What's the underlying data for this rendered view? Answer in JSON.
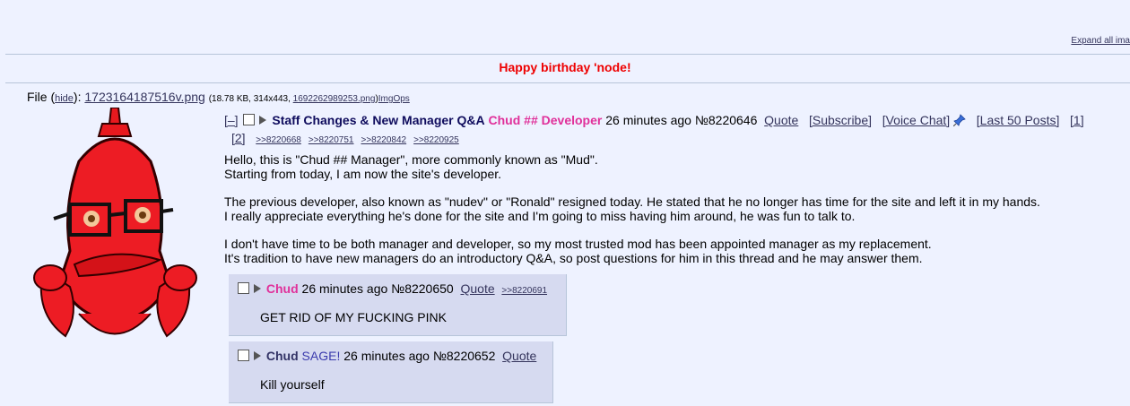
{
  "header": {
    "expand_label": "Expand all ima",
    "banner": "Happy birthday 'node!"
  },
  "file": {
    "label": "File (",
    "hide_label": "hide",
    "label_close": "):",
    "filename": "1723164187516v.png",
    "meta_prefix": "(18.78 KB, 314x443,",
    "orig_name": "1692262989253.png",
    "meta_suffix": ")",
    "imgops": "ImgOps"
  },
  "op": {
    "collapse": "[–]",
    "subject": "Staff Changes & New Manager Q&A",
    "name": "Chud",
    "trip": "## Developer",
    "time": "26 minutes ago",
    "post_no": "№8220646",
    "quote": "Quote",
    "subscribe": "[Subscribe]",
    "voice_chat": "[Voice Chat]",
    "last50": "[Last 50 Posts]",
    "page1": "[1]",
    "page2": "[2]",
    "backlinks": [
      ">>8220668",
      ">>8220751",
      ">>8220842",
      ">>8220925"
    ],
    "paragraphs": [
      [
        "Hello, this is \"Chud ## Manager\", more commonly known as \"Mud\".",
        "Starting from today, I am now the site's developer."
      ],
      [
        "The previous developer, also known as \"nudev\" or \"Ronald\" resigned today. He stated that he no longer has time for the site and left it in my hands.",
        "I really appreciate everything he's done for the site and I'm going to miss having him around, he was fun to talk to."
      ],
      [
        "I don't have time to be both manager and developer, so my most trusted mod has been appointed manager as my replacement.",
        "It's tradition to have new managers do an introductory Q&A, so post questions for him in this thread and he may answer them."
      ]
    ]
  },
  "replies": [
    {
      "name": "Chud",
      "time": "26 minutes ago",
      "post_no": "№8220650",
      "quote": "Quote",
      "backlink": ">>8220691",
      "text": "GET RID OF MY FUCKING PINK"
    },
    {
      "name": "Chud",
      "sage": "SAGE!",
      "time": "26 minutes ago",
      "post_no": "№8220652",
      "quote": "Quote",
      "text": "Kill yourself"
    }
  ]
}
